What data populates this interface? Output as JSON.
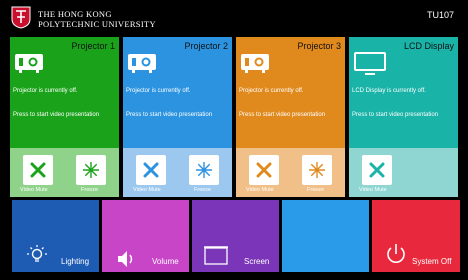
{
  "header": {
    "university_line1": "THE HONG KONG",
    "university_line2": "POLYTECHNIC UNIVERSITY",
    "room": "TU107"
  },
  "panels": [
    {
      "name": "Projector 1",
      "status": "Projector is currently off.",
      "hint": "Press to start video presentation",
      "controls": [
        "Video Mute",
        "Freeze"
      ],
      "color_top": "#1aa31a",
      "color_bottom": "#8fd28a"
    },
    {
      "name": "Projector 2",
      "status": "Projector is currently off.",
      "hint": "Press to start video presentation",
      "controls": [
        "Video Mute",
        "Freeze"
      ],
      "color_top": "#2b93e0",
      "color_bottom": "#9cc8ef"
    },
    {
      "name": "Projector 3",
      "status": "Projector is currently off.",
      "hint": "Press to start video presentation",
      "controls": [
        "Video Mute",
        "Freeze"
      ],
      "color_top": "#e08a1e",
      "color_bottom": "#f0c088"
    },
    {
      "name": "LCD Display",
      "status": "LCD Display is currently off.",
      "hint": "Press to start video presentation",
      "controls": [
        "Video Mute"
      ],
      "color_top": "#19b3a8",
      "color_bottom": "#8fd6d2"
    }
  ],
  "tiles": [
    {
      "label": "Lighting",
      "icon": "light-bulb-icon",
      "color": "#1e5cb3"
    },
    {
      "label": "Volume",
      "icon": "speaker-icon",
      "color": "#c845c8"
    },
    {
      "label": "Screen",
      "icon": "screen-icon",
      "color": "#7a35b8"
    },
    {
      "label": "",
      "icon": "",
      "color": "#2a9be8"
    },
    {
      "label": "System Off",
      "icon": "power-icon",
      "color": "#e8283c"
    }
  ],
  "colors": {
    "mute_green": "#1aa31a",
    "mute_blue": "#2b93e0",
    "mute_orange": "#e08a1e",
    "mute_teal": "#19b3a8"
  }
}
